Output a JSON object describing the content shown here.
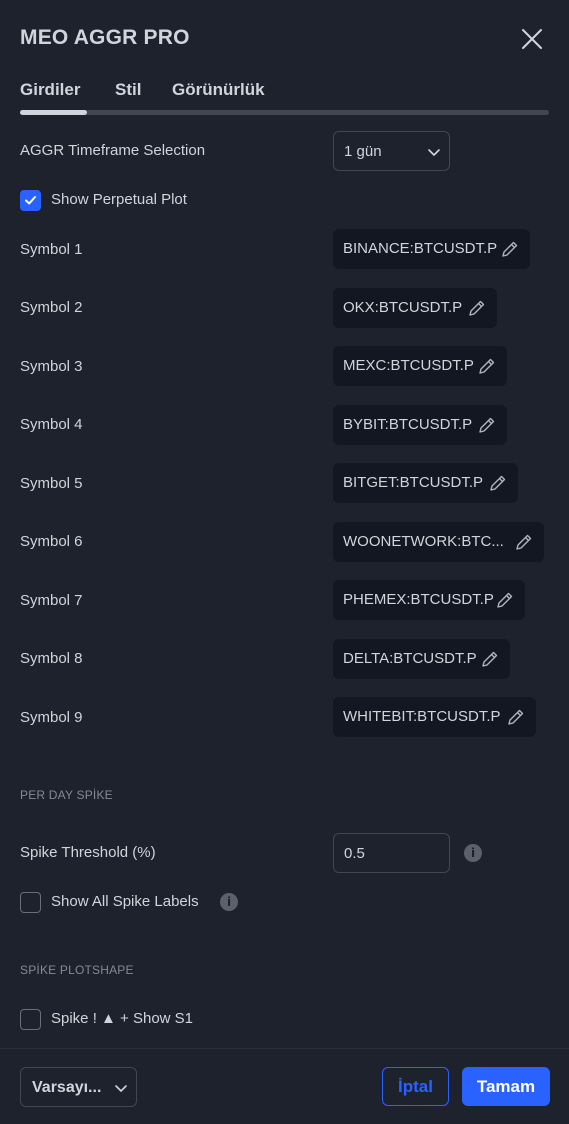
{
  "dialog": {
    "title": "MEO AGGR PRO",
    "close_icon": "close-icon"
  },
  "tabs": [
    {
      "label": "Girdiler",
      "active": true
    },
    {
      "label": "Stil",
      "active": false
    },
    {
      "label": "Görünürlük",
      "active": false
    }
  ],
  "inputs": {
    "timeframe": {
      "label": "AGGR Timeframe Selection",
      "value": "1 gün"
    },
    "show_perpetual": {
      "label": "Show Perpetual Plot",
      "checked": true
    },
    "symbols": [
      {
        "label": "Symbol 1",
        "value": "BINANCE:BTCUSDT.P"
      },
      {
        "label": "Symbol 2",
        "value": "OKX:BTCUSDT.P"
      },
      {
        "label": "Symbol 3",
        "value": "MEXC:BTCUSDT.P"
      },
      {
        "label": "Symbol 4",
        "value": "BYBIT:BTCUSDT.P"
      },
      {
        "label": "Symbol 5",
        "value": "BITGET:BTCUSDT.P"
      },
      {
        "label": "Symbol 6",
        "value": "WOONETWORK:BTC..."
      },
      {
        "label": "Symbol 7",
        "value": "PHEMEX:BTCUSDT.P"
      },
      {
        "label": "Symbol 8",
        "value": "DELTA:BTCUSDT.P"
      },
      {
        "label": "Symbol 9",
        "value": "WHITEBIT:BTCUSDT.P"
      }
    ],
    "section_spike": "PER DAY SPİKE",
    "spike_threshold": {
      "label": "Spike Threshold (%)",
      "value": "0.5"
    },
    "show_all_spike_labels": {
      "label": "Show All Spike Labels",
      "checked": false
    },
    "section_plotshape": "SPİKE PLOTSHAPE",
    "spike_show_s1": {
      "label": "Spike ! ▲ + Show S1",
      "checked": false
    }
  },
  "footer": {
    "defaults_label": "Varsayı...",
    "cancel_label": "İptal",
    "ok_label": "Tamam"
  },
  "colors": {
    "background": "#1e222d",
    "accent": "#2962ff",
    "text": "#d1d4dc",
    "muted": "#868993",
    "field_bg": "#131722"
  }
}
